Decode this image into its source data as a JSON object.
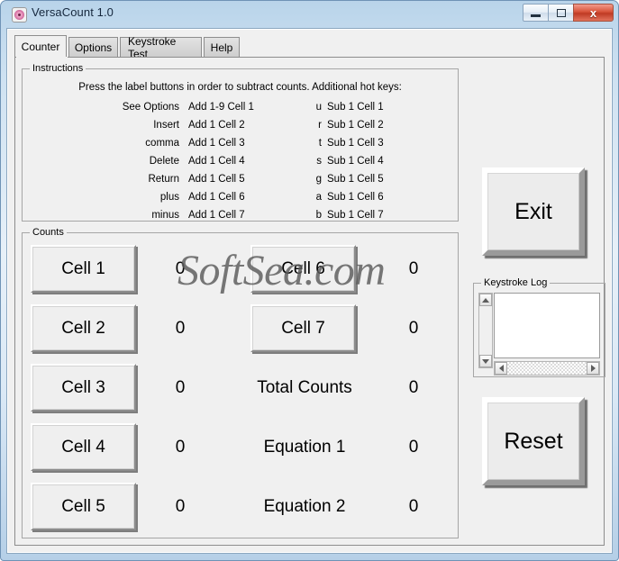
{
  "window": {
    "title": "VersaCount 1.0",
    "icon": "app-disc-icon",
    "minimize_label": "",
    "maximize_label": "",
    "close_label": "x"
  },
  "tabs": [
    {
      "label": "Counter",
      "active": true
    },
    {
      "label": "Options",
      "active": false
    },
    {
      "label": "Keystroke Test",
      "active": false
    },
    {
      "label": "Help",
      "active": false
    }
  ],
  "instructions": {
    "group_title": "Instructions",
    "headline": "Press the label buttons in order to subtract counts.  Additional hot keys:",
    "rows": [
      {
        "key": "See Options",
        "add": "Add 1-9 Cell 1",
        "hotkey": "u",
        "sub": "Sub 1 Cell 1"
      },
      {
        "key": "Insert",
        "add": "Add 1 Cell 2",
        "hotkey": "r",
        "sub": "Sub 1 Cell 2"
      },
      {
        "key": "comma",
        "add": "Add 1 Cell 3",
        "hotkey": "t",
        "sub": "Sub 1 Cell 3"
      },
      {
        "key": "Delete",
        "add": "Add 1 Cell 4",
        "hotkey": "s",
        "sub": "Sub 1 Cell 4"
      },
      {
        "key": "Return",
        "add": "Add 1 Cell 5",
        "hotkey": "g",
        "sub": "Sub 1 Cell 5"
      },
      {
        "key": "plus",
        "add": "Add 1 Cell 6",
        "hotkey": "a",
        "sub": "Sub 1 Cell 6"
      },
      {
        "key": "minus",
        "add": "Add 1 Cell 7",
        "hotkey": "b",
        "sub": "Sub 1 Cell 7"
      }
    ]
  },
  "counts": {
    "group_title": "Counts",
    "left_column": [
      {
        "button": "Cell 1",
        "value": "0"
      },
      {
        "button": "Cell 2",
        "value": "0"
      },
      {
        "button": "Cell 3",
        "value": "0"
      },
      {
        "button": "Cell 4",
        "value": "0"
      },
      {
        "button": "Cell 5",
        "value": "0"
      }
    ],
    "right_column": [
      {
        "label": "Cell 6",
        "is_button": true,
        "value": "0"
      },
      {
        "label": "Cell 7",
        "is_button": true,
        "value": "0"
      },
      {
        "label": "Total Counts",
        "is_button": false,
        "value": "0"
      },
      {
        "label": "Equation 1",
        "is_button": false,
        "value": "0"
      },
      {
        "label": "Equation 2",
        "is_button": false,
        "value": "0"
      }
    ]
  },
  "side": {
    "exit_label": "Exit",
    "reset_label": "Reset",
    "log_group_title": "Keystroke Log",
    "log_content": ""
  },
  "watermark": {
    "text": "SoftSea.com"
  }
}
